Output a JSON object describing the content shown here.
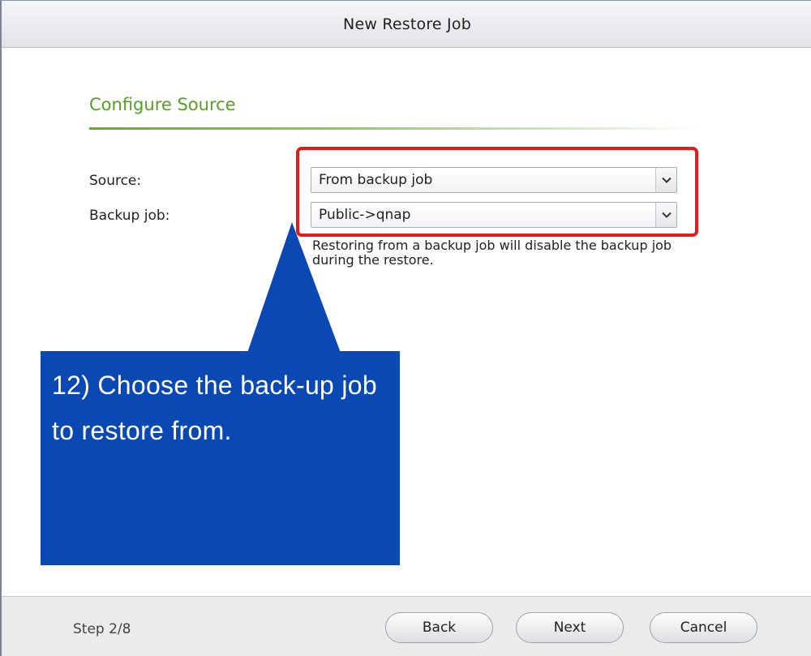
{
  "dialog": {
    "title": "New Restore Job"
  },
  "section": {
    "title": "Configure Source"
  },
  "form": {
    "source": {
      "label": "Source:",
      "value": "From backup job"
    },
    "backup_job": {
      "label": "Backup job:",
      "value": "Public->qnap"
    },
    "help_text": "Restoring from a backup job will disable the backup job during the restore."
  },
  "callout": {
    "text": "12) Choose the back-up job to restore from.",
    "color": "#0a48b3"
  },
  "highlight": {
    "color": "#e31b1b"
  },
  "footer": {
    "step": "Step 2/8",
    "back_label": "Back",
    "next_label": "Next",
    "cancel_label": "Cancel"
  },
  "icons": {
    "dropdown": "chevron-down-icon"
  }
}
